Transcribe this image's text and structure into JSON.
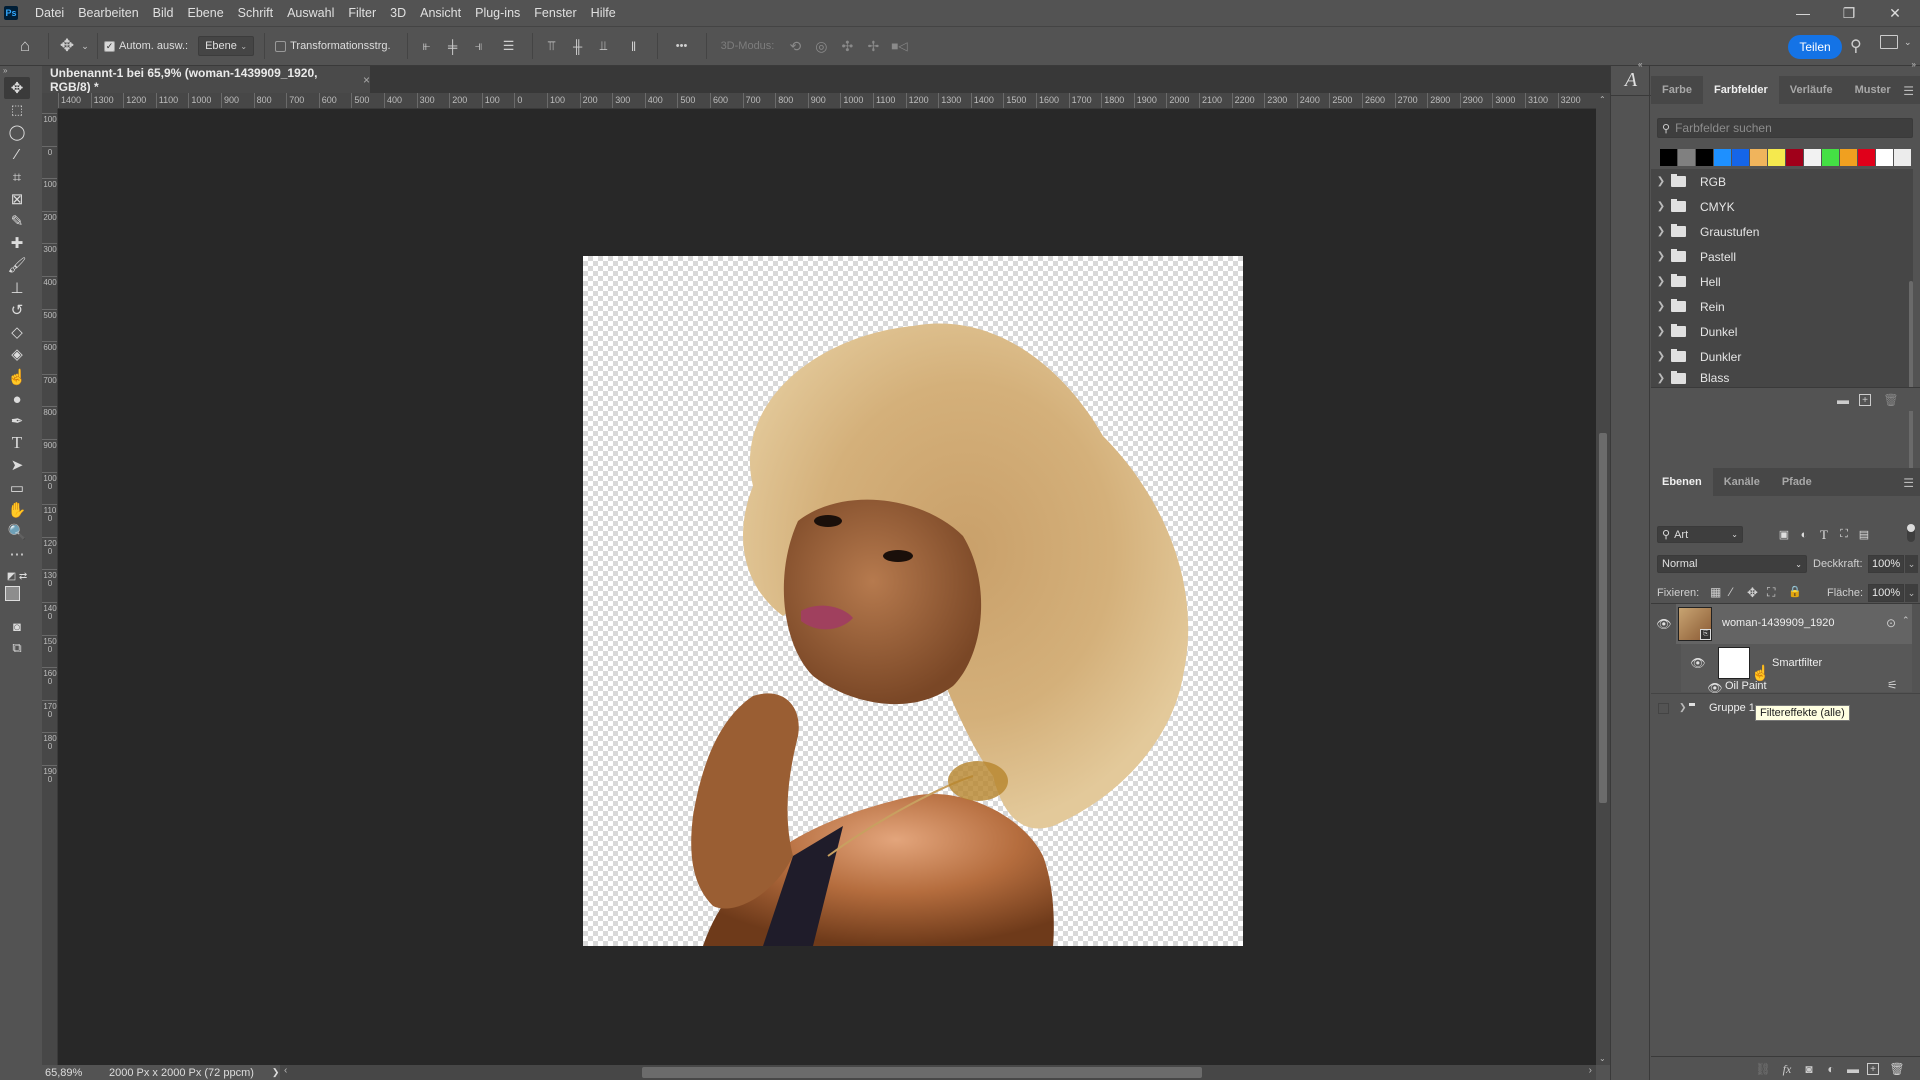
{
  "app": {
    "logo": "Ps"
  },
  "menubar": {
    "items": [
      "Datei",
      "Bearbeiten",
      "Bild",
      "Ebene",
      "Schrift",
      "Auswahl",
      "Filter",
      "3D",
      "Ansicht",
      "Plug-ins",
      "Fenster",
      "Hilfe"
    ]
  },
  "window_controls": {
    "minimize": "—",
    "restore": "❐",
    "close": "✕"
  },
  "options_bar": {
    "auto_select_label": "Autom. ausw.:",
    "auto_select_checked": true,
    "auto_select_target": "Ebene",
    "transform_controls_label": "Transformationsstrg.",
    "transform_controls_checked": false,
    "more_label": "•••",
    "mode_3d_label": "3D-Modus:",
    "share_label": "Teilen"
  },
  "document": {
    "tab_title": "Unbenannt-1 bei 65,9% (woman-1439909_1920, RGB/8) *",
    "close_label": "×"
  },
  "rulers": {
    "horizontal_ticks": [
      "1400",
      "1300",
      "1200",
      "1100",
      "1000",
      "900",
      "800",
      "700",
      "600",
      "500",
      "400",
      "300",
      "200",
      "100",
      "0",
      "100",
      "200",
      "300",
      "400",
      "500",
      "600",
      "700",
      "800",
      "900",
      "1000",
      "1100",
      "1200",
      "1300",
      "1400",
      "1500",
      "1600",
      "1700",
      "1800",
      "1900",
      "2000",
      "2100",
      "2200",
      "2300",
      "2400",
      "2500",
      "2600",
      "2700",
      "2800",
      "2900",
      "3000",
      "3100",
      "3200"
    ],
    "vertical_ticks": [
      "100",
      "0",
      "100",
      "200",
      "300",
      "400",
      "500",
      "600",
      "700",
      "800",
      "900",
      "1000",
      "1100",
      "1200",
      "1300",
      "1400",
      "1500",
      "1600",
      "1700",
      "1800",
      "1900"
    ]
  },
  "status_bar": {
    "zoom": "65,89%",
    "doc_info": "2000 Px x 2000 Px (72 ppcm)",
    "arrow": "❯"
  },
  "swatches_panel": {
    "tabs": [
      "Farbe",
      "Farbfelder",
      "Verläufe",
      "Muster"
    ],
    "active_tab": "Farbfelder",
    "search_placeholder": "Farbfelder suchen",
    "recent_colors": [
      "#000000",
      "#808080",
      "#000000",
      "#1e90ff",
      "#1565e8",
      "#f0b45c",
      "#f5e94e",
      "#a0001a",
      "#f2f2f2",
      "#44e044",
      "#f0a020",
      "#e0001a",
      "#ffffff",
      "#ececec"
    ],
    "groups": [
      "RGB",
      "CMYK",
      "Graustufen",
      "Pastell",
      "Hell",
      "Rein",
      "Dunkel",
      "Dunkler",
      "Blass"
    ]
  },
  "layers_panel": {
    "tabs": [
      "Ebenen",
      "Kanäle",
      "Pfade"
    ],
    "active_tab": "Ebenen",
    "filter_label": "Art",
    "blend_mode": "Normal",
    "opacity_label": "Deckkraft:",
    "opacity_value": "100%",
    "lock_label": "Fixieren:",
    "fill_label": "Fläche:",
    "fill_value": "100%",
    "layers": [
      {
        "name": "woman-1439909_1920",
        "type": "smart-object",
        "visible": true
      },
      {
        "name": "Smartfilter",
        "type": "smart-filter-mask",
        "visible": true
      },
      {
        "name": "Oil Paint",
        "type": "filter",
        "visible": true
      },
      {
        "name": "Gruppe 1",
        "type": "group",
        "visible": false
      }
    ],
    "tooltip": "Filtereffekte (alle)"
  }
}
